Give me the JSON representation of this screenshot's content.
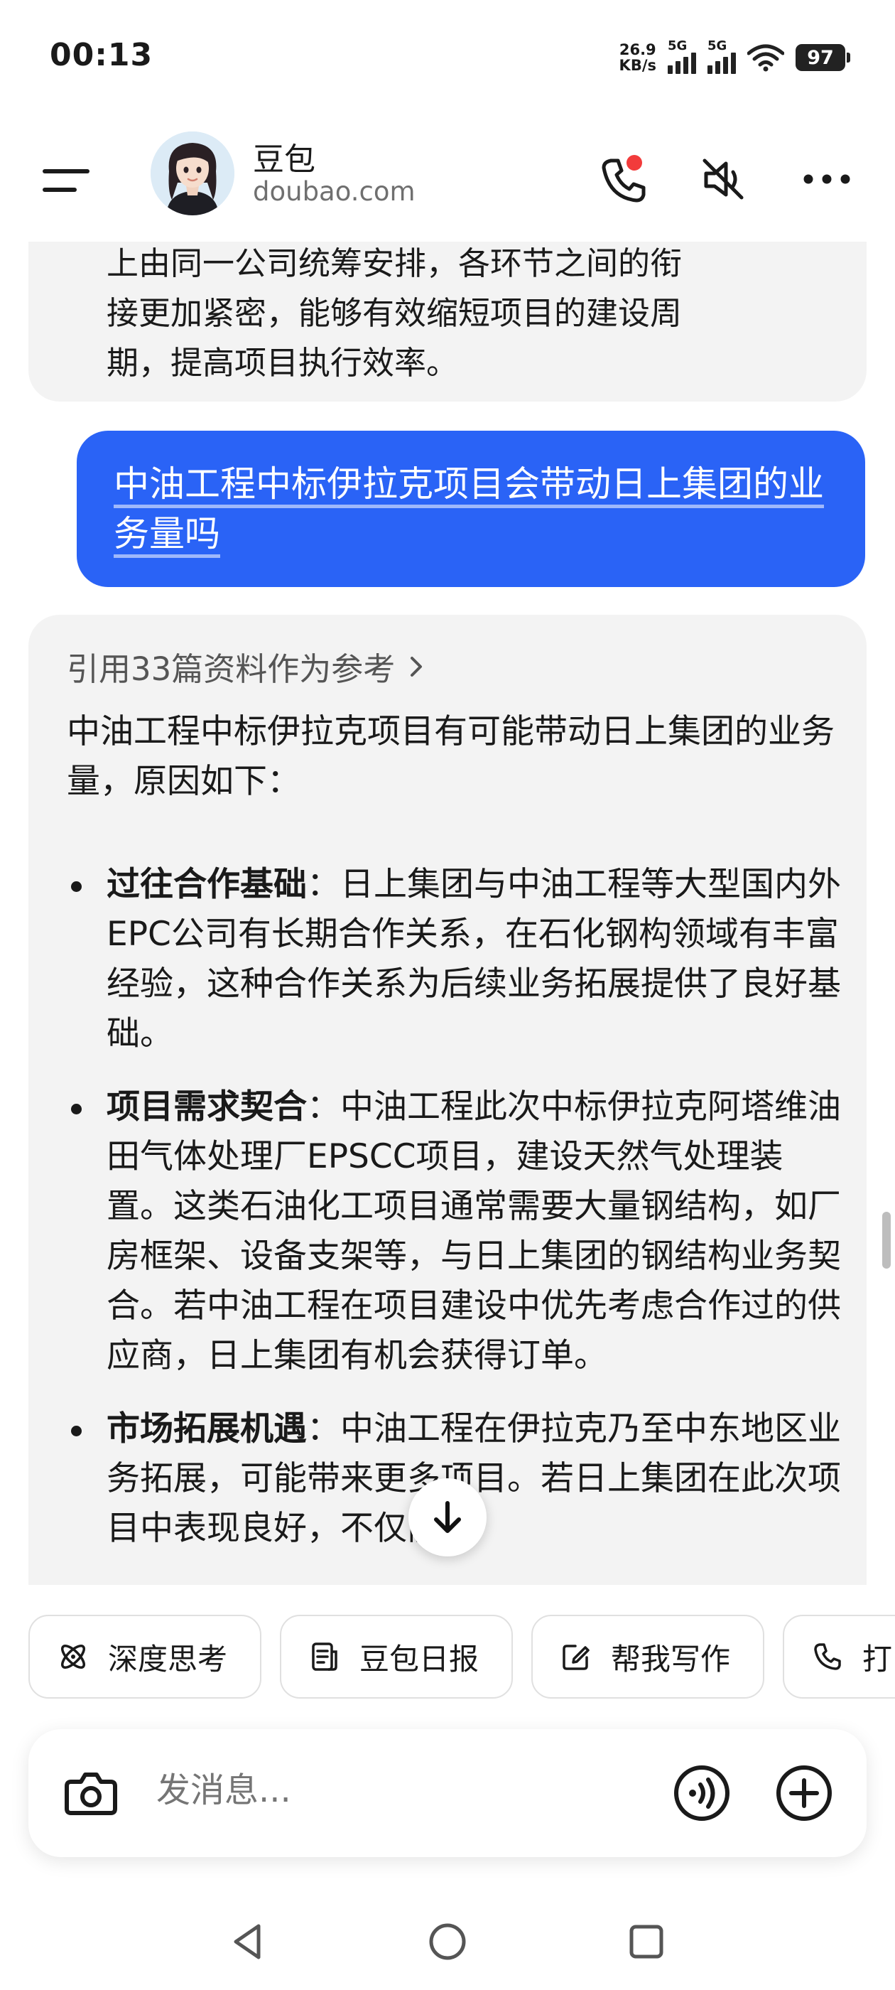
{
  "status_bar": {
    "time": "00:13",
    "net_speed_value": "26.9",
    "net_speed_unit": "KB/s",
    "network_1": "5G",
    "network_2": "5G",
    "battery": "97"
  },
  "header": {
    "bot_name": "豆包",
    "bot_domain": "doubao.com",
    "icons": [
      "menu-icon",
      "phone-call-icon",
      "mute-icon",
      "more-icon"
    ],
    "notification_dot_color": "#f23b3b"
  },
  "chat": {
    "previous_reply_lines": [
      "上由同一公司统筹安排，各环节之间的衔",
      "接更加紧密，能够有效缩短项目的建设周",
      "期，提高项目执行效率。"
    ],
    "user_message": "中油工程中标伊拉克项目会带动日上集团的业务量吗",
    "user_bubble_color": "#2a63f6",
    "references_label": "引用33篇资料作为参考",
    "answer_intro": "中油工程中标伊拉克项目有可能带动日上集团的业务量，原因如下：",
    "bullets": [
      {
        "title": "过往合作基础",
        "text": "：日上集团与中油工程等大型国内外EPC公司有长期合作关系，在石化钢构领域有丰富经验，这种合作关系为后续业务拓展提供了良好基础。"
      },
      {
        "title": "项目需求契合",
        "text": "：中油工程此次中标伊拉克阿塔维油田气体处理厂EPSCC项目，建设天然气处理装置。这类石油化工项目通常需要大量钢结构，如厂房框架、设备支架等，与日上集团的钢结构业务契合。若中油工程在项目建设中优先考虑合作过的供应商，日上集团有机会获得订单。"
      },
      {
        "title": "市场拓展机遇",
        "text": "：中油工程在伊拉克乃至中东地区业务拓展，可能带来更多项目。若日上集团在此次项目中表现良好，不仅能"
      }
    ]
  },
  "quick_actions": [
    {
      "label": "深度思考",
      "icon": "deep-think-icon"
    },
    {
      "label": "豆包日报",
      "icon": "daily-report-icon"
    },
    {
      "label": "帮我写作",
      "icon": "write-icon"
    },
    {
      "label": "打",
      "icon": "phone-icon"
    }
  ],
  "input": {
    "placeholder": "发消息...",
    "icons": [
      "camera-icon",
      "voice-icon",
      "add-icon"
    ]
  },
  "nav_bar": {
    "icons": [
      "back-icon",
      "home-icon",
      "recents-icon"
    ]
  }
}
